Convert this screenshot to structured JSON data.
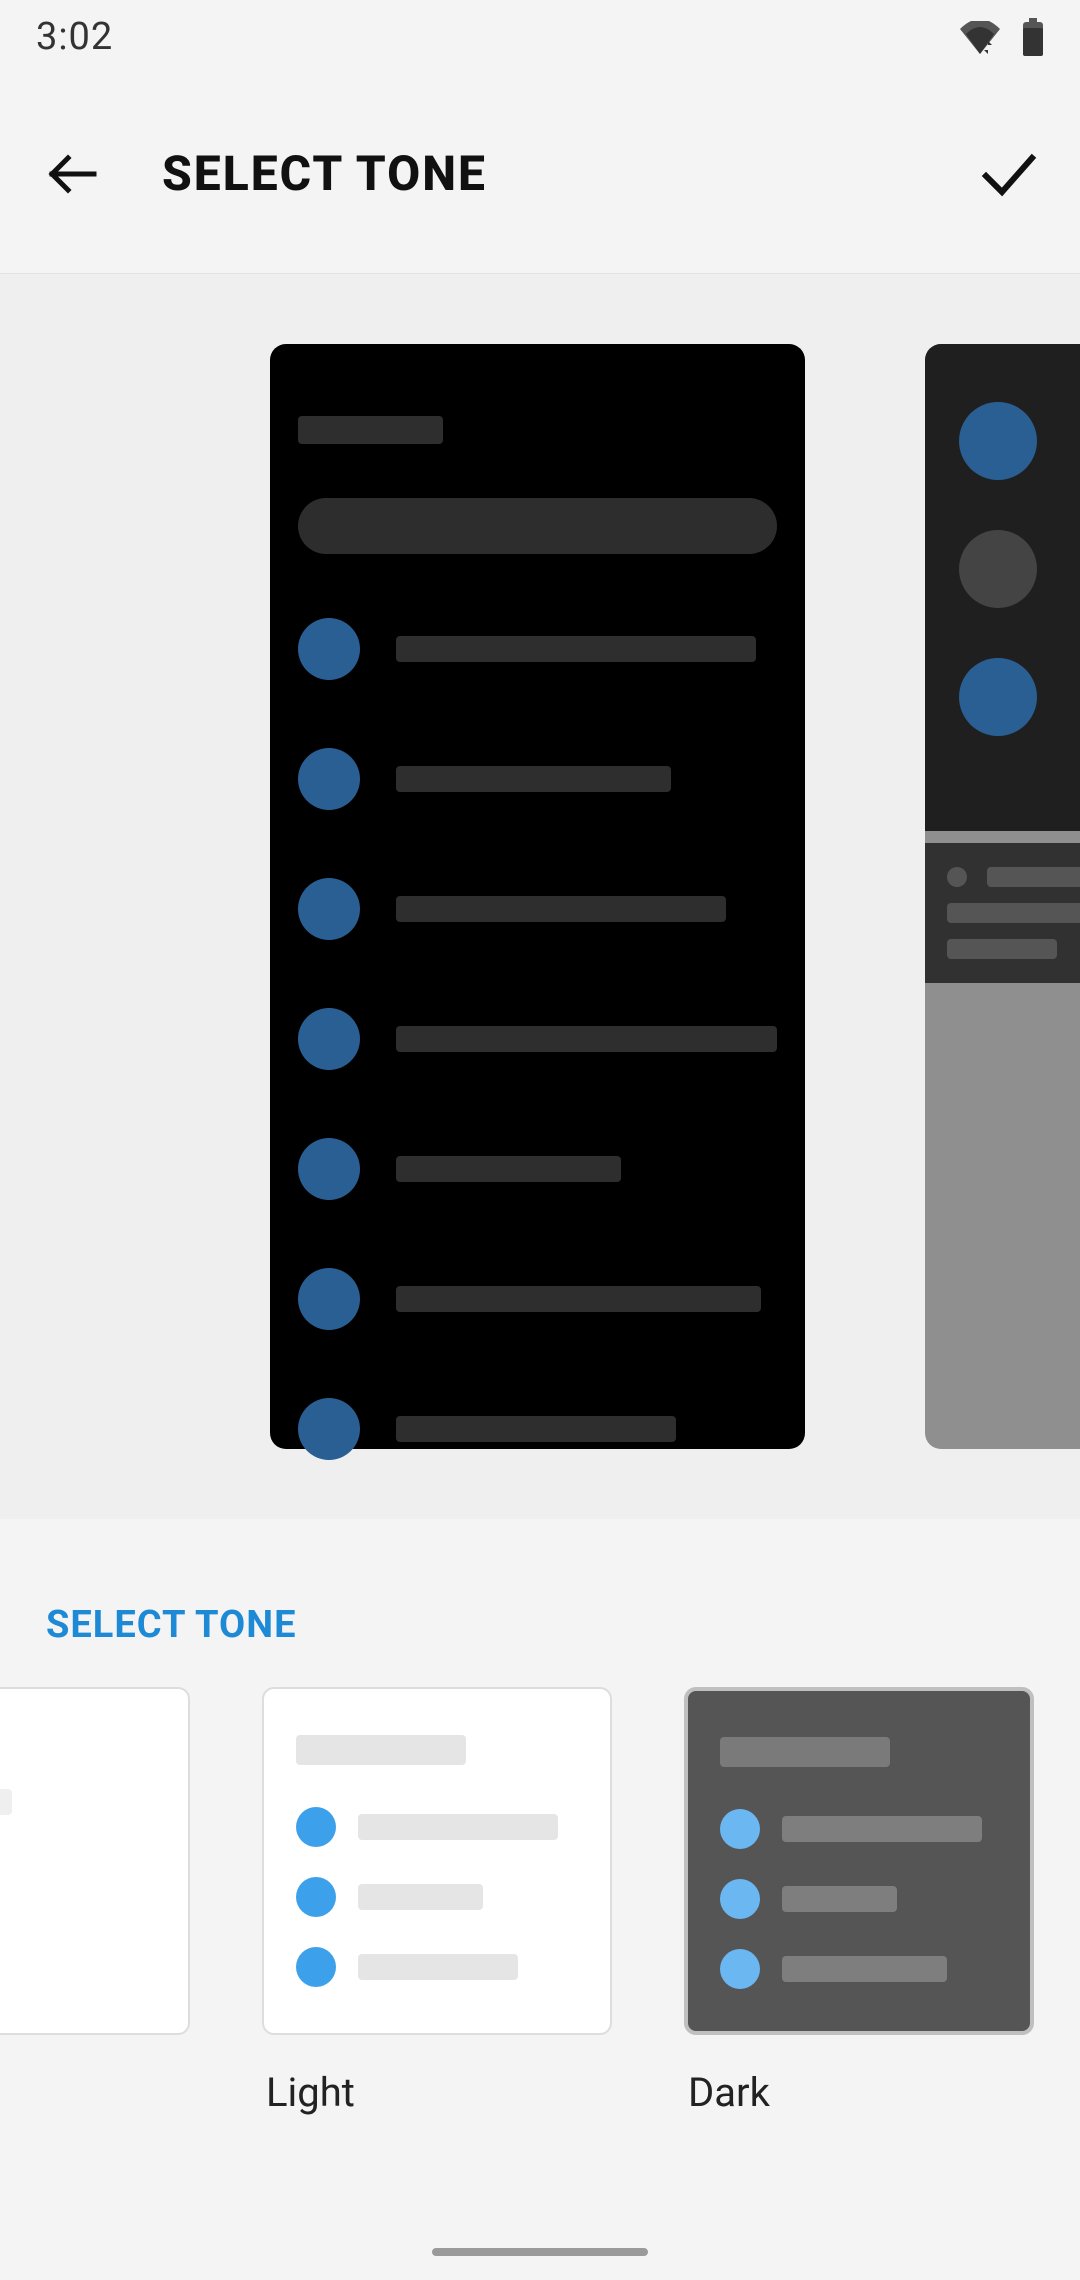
{
  "statusbar": {
    "time": "3:02"
  },
  "appbar": {
    "title": "SELECT TONE"
  },
  "section": {
    "header": "SELECT TONE"
  },
  "tones": {
    "light": {
      "label": "Light",
      "selected": false
    },
    "dark": {
      "label": "Dark",
      "selected": true
    }
  }
}
